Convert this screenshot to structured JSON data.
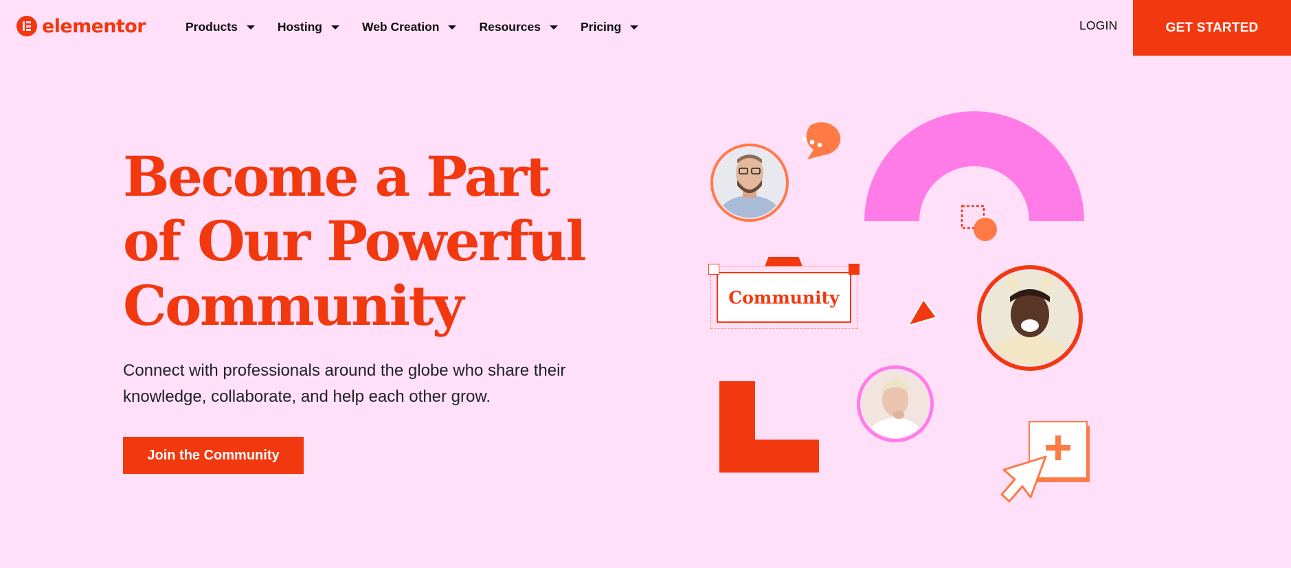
{
  "brand": {
    "name": "elementor",
    "color": "#F2380F"
  },
  "nav": {
    "items": [
      {
        "label": "Products"
      },
      {
        "label": "Hosting"
      },
      {
        "label": "Web Creation"
      },
      {
        "label": "Resources"
      },
      {
        "label": "Pricing"
      }
    ],
    "login_label": "LOGIN",
    "get_started_label": "GET STARTED"
  },
  "hero": {
    "title_lines": [
      "Become a Part",
      "of Our Powerful",
      "Community"
    ],
    "subtitle_lines": [
      "Connect with professionals around the globe who share their",
      "knowledge, collaborate, and help each other grow."
    ],
    "cta_label": "Join the Community"
  },
  "illustration": {
    "widget_label": "Community",
    "icons": [
      "chat-bubble-icon",
      "cursor-arrow-icon",
      "plus-icon",
      "pointer-triangle-icon"
    ]
  },
  "colors": {
    "background": "#FFE0F8",
    "accent": "#F2380F",
    "pink": "#FF7CE8",
    "orange_soft": "#FF7A45"
  }
}
